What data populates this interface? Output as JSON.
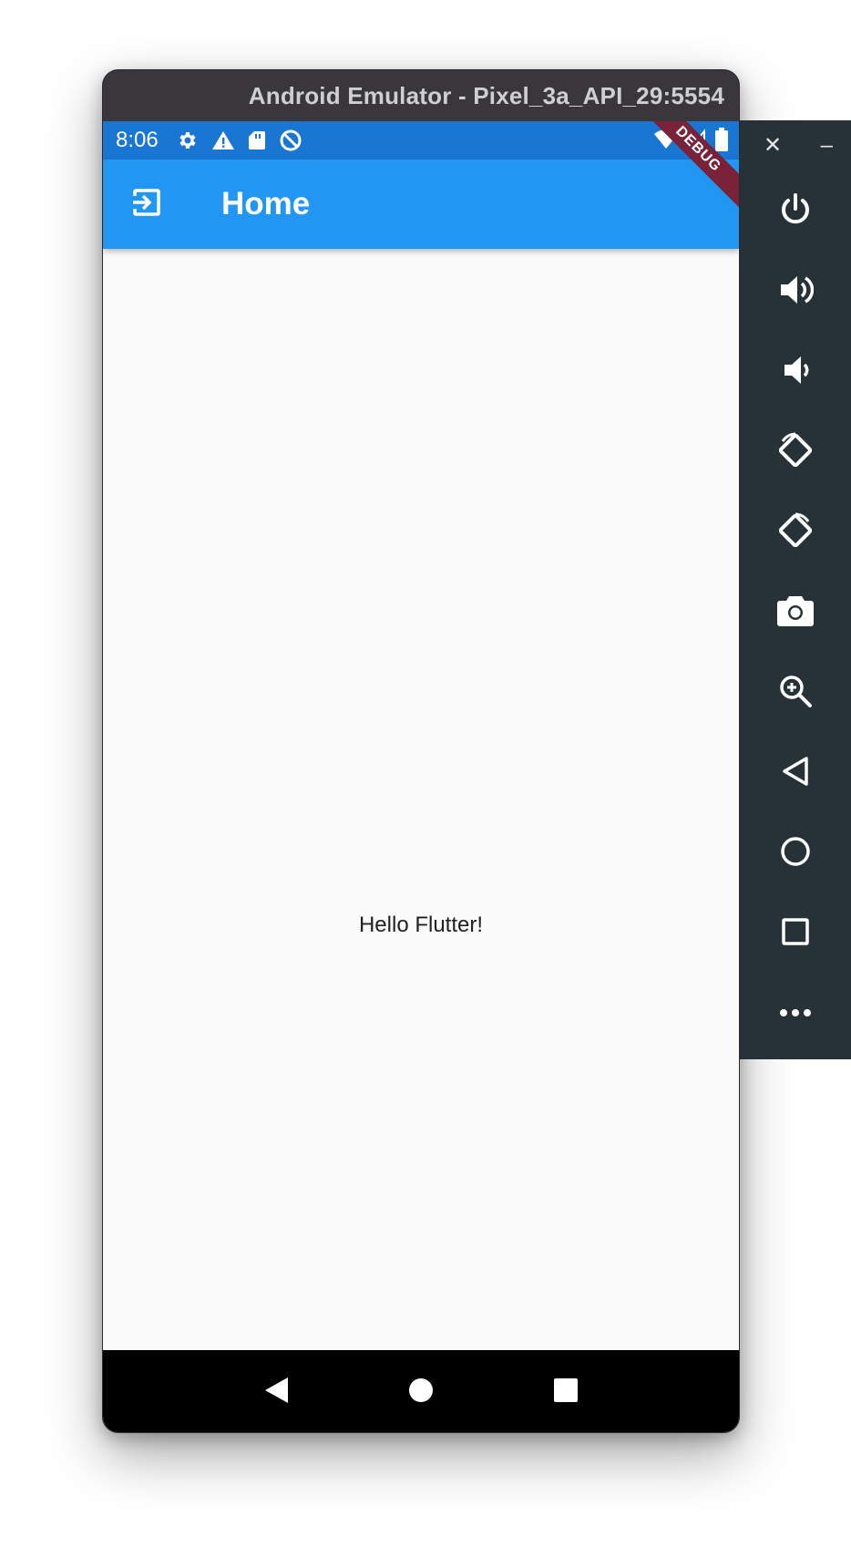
{
  "window": {
    "title": "Android Emulator - Pixel_3a_API_29:5554"
  },
  "status_bar": {
    "time": "8:06",
    "left_icons": [
      "gear-icon",
      "warning-icon",
      "sd-card-icon",
      "sync-disabled-icon"
    ],
    "right_icons": [
      "wifi-icon",
      "cell-signal-icon",
      "battery-icon"
    ]
  },
  "app_bar": {
    "title": "Home",
    "leading_icon": "exit-to-app-icon",
    "color": "#2196f3"
  },
  "debug_banner": "DEBUG",
  "body": {
    "text": "Hello Flutter!"
  },
  "nav_bar": {
    "buttons": [
      "back",
      "home",
      "overview"
    ]
  },
  "toolbar": {
    "window_controls": {
      "close": "✕",
      "minimize": "–"
    },
    "buttons": [
      "power",
      "volume-up",
      "volume-down",
      "rotate-left",
      "rotate-right",
      "screenshot",
      "zoom",
      "back",
      "home",
      "overview",
      "more"
    ]
  },
  "colors": {
    "status_bar": "#1976d2",
    "toolbar": "#263238",
    "title_bar": "#3a373c",
    "debug_banner": "#7a2239"
  }
}
